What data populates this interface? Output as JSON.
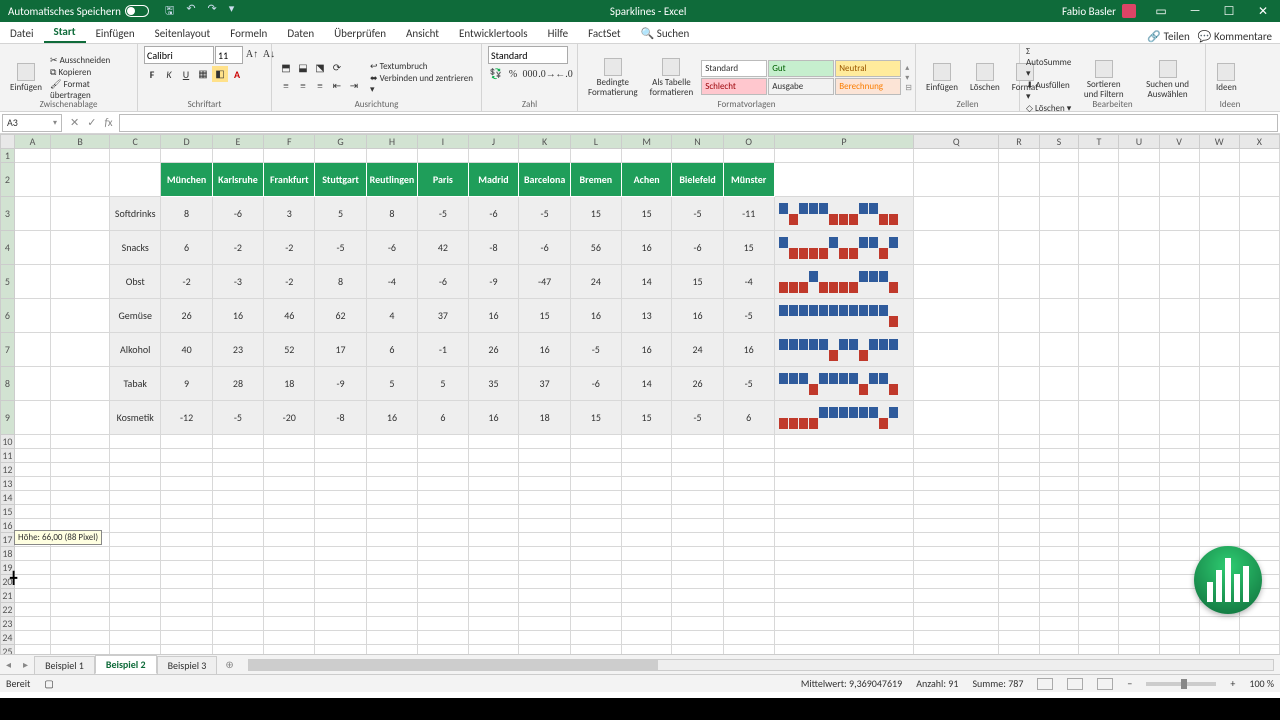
{
  "title": {
    "autosave": "Automatisches Speichern",
    "doc": "Sparklines",
    "app": "Excel",
    "user": "Fabio Basler"
  },
  "menu": {
    "tabs": [
      "Datei",
      "Start",
      "Einfügen",
      "Seitenlayout",
      "Formeln",
      "Daten",
      "Überprüfen",
      "Ansicht",
      "Entwicklertools",
      "Hilfe",
      "FactSet"
    ],
    "search": "Suchen",
    "share": "Teilen",
    "comments": "Kommentare"
  },
  "ribbon": {
    "clipboard": {
      "label": "Zwischenablage",
      "paste": "Einfügen",
      "cut": "Ausschneiden",
      "copy": "Kopieren",
      "fmt": "Format übertragen"
    },
    "font": {
      "label": "Schriftart",
      "name": "Calibri",
      "size": "11"
    },
    "align": {
      "label": "Ausrichtung",
      "wrap": "Textumbruch",
      "merge": "Verbinden und zentrieren"
    },
    "number": {
      "label": "Zahl",
      "format": "Standard"
    },
    "styles": {
      "label": "Formatvorlagen",
      "cond": "Bedingte Formatierung",
      "astable": "Als Tabelle formatieren",
      "s": [
        "Standard",
        "Gut",
        "Neutral",
        "Schlecht",
        "Ausgabe",
        "Berechnung"
      ]
    },
    "cells": {
      "label": "Zellen",
      "insert": "Einfügen",
      "delete": "Löschen",
      "format": "Format"
    },
    "editing": {
      "label": "Bearbeiten",
      "sum": "AutoSumme",
      "fill": "Ausfüllen",
      "clear": "Löschen",
      "sort": "Sortieren und Filtern",
      "find": "Suchen und Auswählen"
    },
    "ideas": {
      "label": "Ideen",
      "btn": "Ideen"
    }
  },
  "namebox": "A3",
  "chart_data": {
    "type": "table",
    "columns": [
      "München",
      "Karlsruhe",
      "Frankfurt",
      "Stuttgart",
      "Reutlingen",
      "Paris",
      "Madrid",
      "Barcelona",
      "Bremen",
      "Achen",
      "Bielefeld",
      "Münster"
    ],
    "rows": [
      "Softdrinks",
      "Snacks",
      "Obst",
      "Gemüse",
      "Alkohol",
      "Tabak",
      "Kosmetik"
    ],
    "values": [
      [
        8,
        -6,
        3,
        5,
        8,
        -5,
        -6,
        -5,
        15,
        15,
        -5,
        -11
      ],
      [
        6,
        -2,
        -2,
        -5,
        -6,
        42,
        -8,
        -6,
        56,
        16,
        -6,
        15
      ],
      [
        -2,
        -3,
        -2,
        8,
        -4,
        -6,
        -9,
        -47,
        24,
        14,
        15,
        -4
      ],
      [
        26,
        16,
        46,
        62,
        4,
        37,
        16,
        15,
        16,
        13,
        16,
        -5
      ],
      [
        40,
        23,
        52,
        17,
        6,
        -1,
        26,
        16,
        -5,
        16,
        24,
        16
      ],
      [
        9,
        28,
        18,
        -9,
        5,
        5,
        35,
        37,
        -6,
        14,
        26,
        -5
      ],
      [
        -12,
        -5,
        -20,
        -8,
        16,
        6,
        16,
        18,
        15,
        15,
        -5,
        6
      ]
    ]
  },
  "rowtip": "Höhe: 66,00 (88 Pixel)",
  "sheets": {
    "tabs": [
      "Beispiel 1",
      "Beispiel 2",
      "Beispiel 3"
    ],
    "active": 1
  },
  "status": {
    "ready": "Bereit",
    "avg_l": "Mittelwert:",
    "avg": "9,369047619",
    "cnt_l": "Anzahl:",
    "cnt": "91",
    "sum_l": "Summe:",
    "sum": "787",
    "zoom": "100 %"
  },
  "cols": [
    "A",
    "B",
    "C",
    "D",
    "E",
    "F",
    "G",
    "H",
    "I",
    "J",
    "K",
    "L",
    "M",
    "N",
    "O",
    "P",
    "Q",
    "R",
    "S",
    "T",
    "U",
    "V",
    "W",
    "X"
  ]
}
